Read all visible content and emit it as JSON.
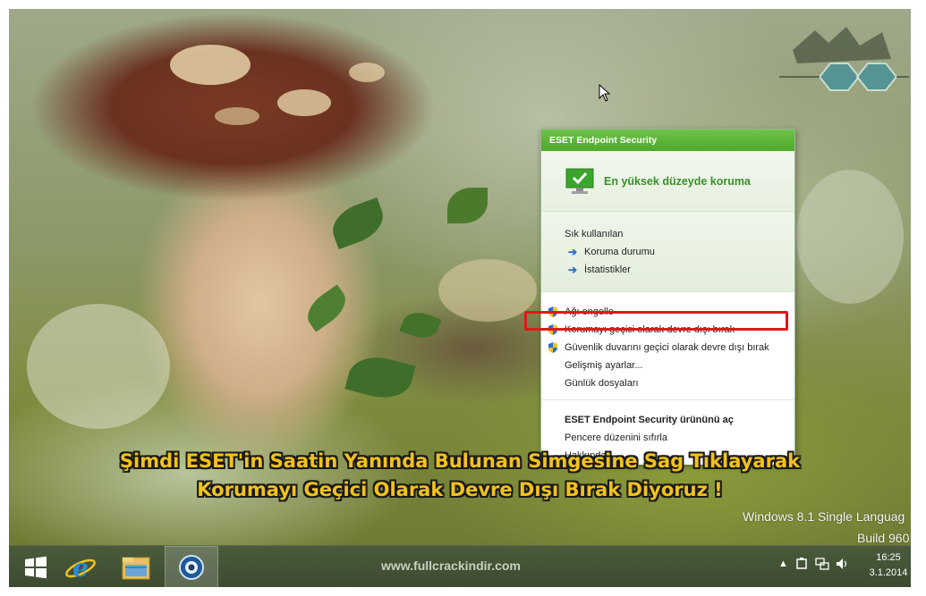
{
  "eset_menu": {
    "title": "ESET Endpoint Security",
    "status": "En yüksek düzeyde koruma",
    "frequent_title": "Sık kullanılan",
    "frequent_items": [
      "Koruma durumu",
      "İstatistikler"
    ],
    "actions": [
      "Ağı engelle",
      "Korumayı geçici olarak devre dışı bırak",
      "Güvenlik duvarını geçici olarak devre dışı bırak",
      "Gelişmiş ayarlar...",
      "Günlük dosyaları"
    ],
    "bottom_items": [
      "ESET Endpoint Security ürününü aç",
      "Pencere düzenini sıfırla",
      "Hakkında"
    ],
    "highlight_color": "#e01818",
    "accent_color": "#4ea82a"
  },
  "caption": {
    "line1": "Şimdi ESET'in Saatin Yanında Bulunan Simgesine Sag Tıklayarak",
    "line2": "Korumayı Geçici Olarak Devre Dışı Bırak Diyoruz !",
    "color": "#f2c21a"
  },
  "watermark": {
    "line1": "Windows 8.1 Single Languag",
    "line2": "Build 960"
  },
  "taskbar": {
    "site_url": "www.fullcrackindir.com",
    "time": "16:25",
    "date": "3.1.2014",
    "apps": [
      "start-button",
      "internet-explorer",
      "file-explorer",
      "eset-app"
    ]
  }
}
